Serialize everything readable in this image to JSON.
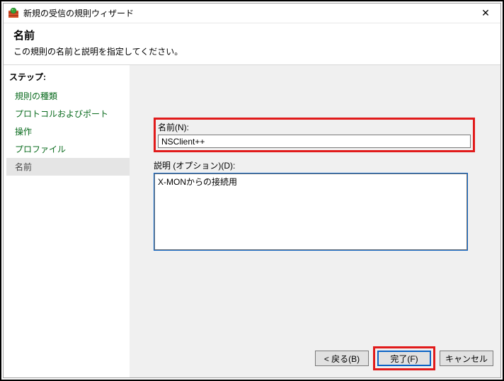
{
  "titlebar": {
    "title": "新規の受信の規則ウィザード",
    "close_glyph": "✕"
  },
  "heading": {
    "title": "名前",
    "desc": "この規則の名前と説明を指定してください。"
  },
  "sidebar": {
    "heading": "ステップ:",
    "items": [
      {
        "label": "規則の種類"
      },
      {
        "label": "プロトコルおよびポート"
      },
      {
        "label": "操作"
      },
      {
        "label": "プロファイル"
      },
      {
        "label": "名前"
      }
    ],
    "current_index": 4
  },
  "form": {
    "name_label": "名前(N):",
    "name_value": "NSClient++",
    "desc_label": "説明 (オプション)(D):",
    "desc_value": "X-MONからの接続用"
  },
  "buttons": {
    "back": "< 戻る(B)",
    "finish": "完了(F)",
    "cancel": "キャンセル"
  }
}
